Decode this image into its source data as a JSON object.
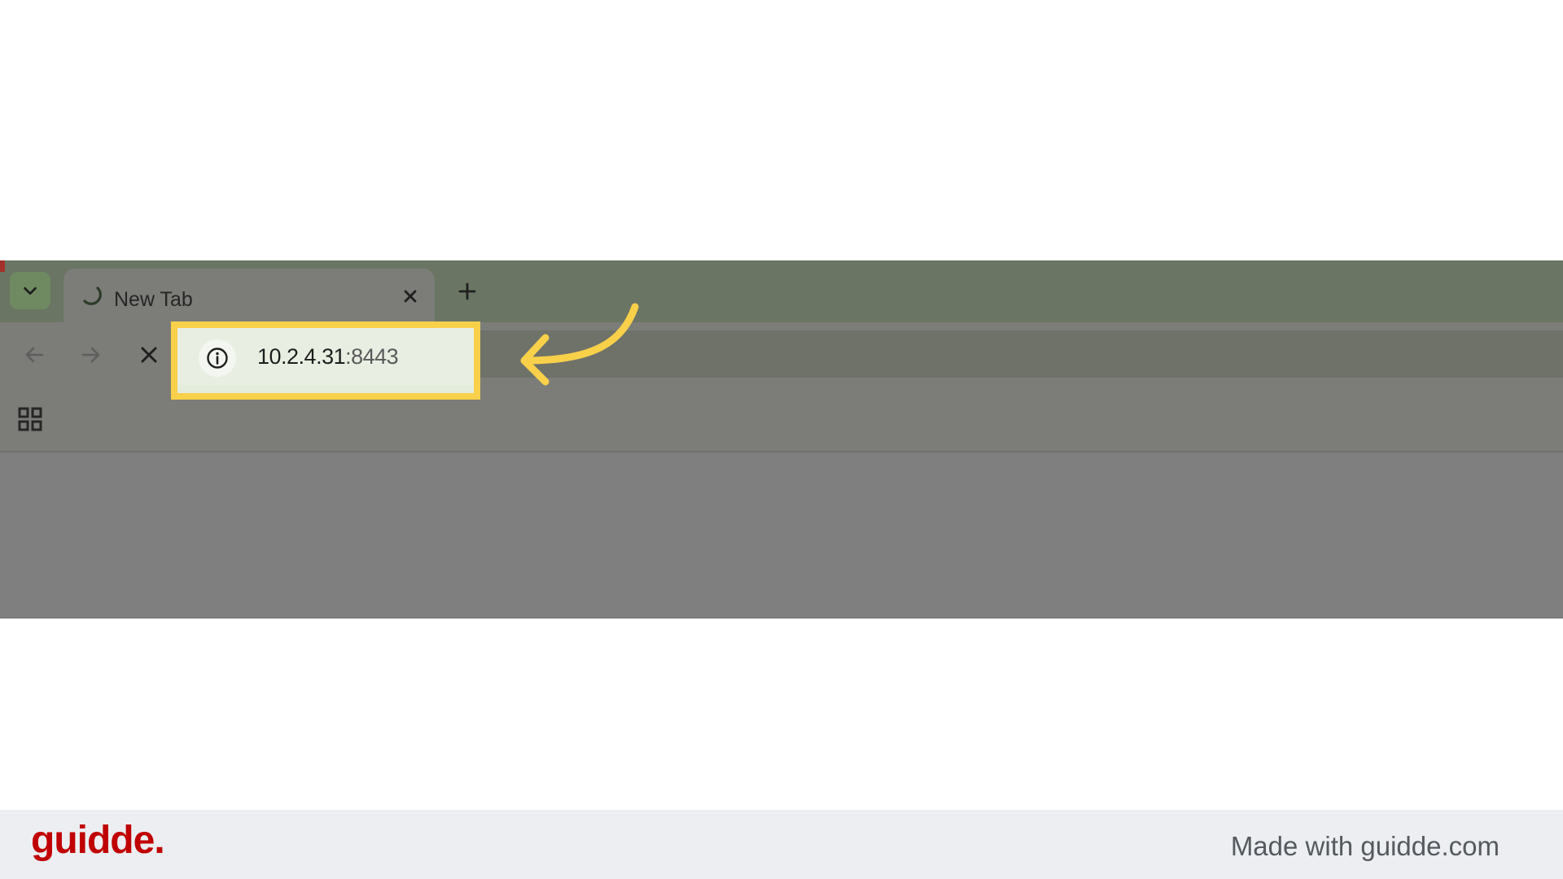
{
  "browser": {
    "tab": {
      "title": "New Tab"
    },
    "address": {
      "host": "10.2.4.31",
      "port": ":8443"
    }
  },
  "footer": {
    "logo": "guidde.",
    "made_with": "Made with guidde.com"
  },
  "colors": {
    "highlight": "#f8d04a",
    "arrow": "#f8d04a",
    "logo": "#c00000"
  },
  "icons": {
    "tab_search": "chevron-down-icon",
    "tab_loading": "loading-spinner-icon",
    "tab_close": "close-icon",
    "new_tab": "plus-icon",
    "back": "arrow-left-icon",
    "forward": "arrow-right-icon",
    "stop": "close-icon",
    "site_info": "info-icon",
    "apps": "apps-grid-icon",
    "annotation": "curved-arrow-icon"
  }
}
